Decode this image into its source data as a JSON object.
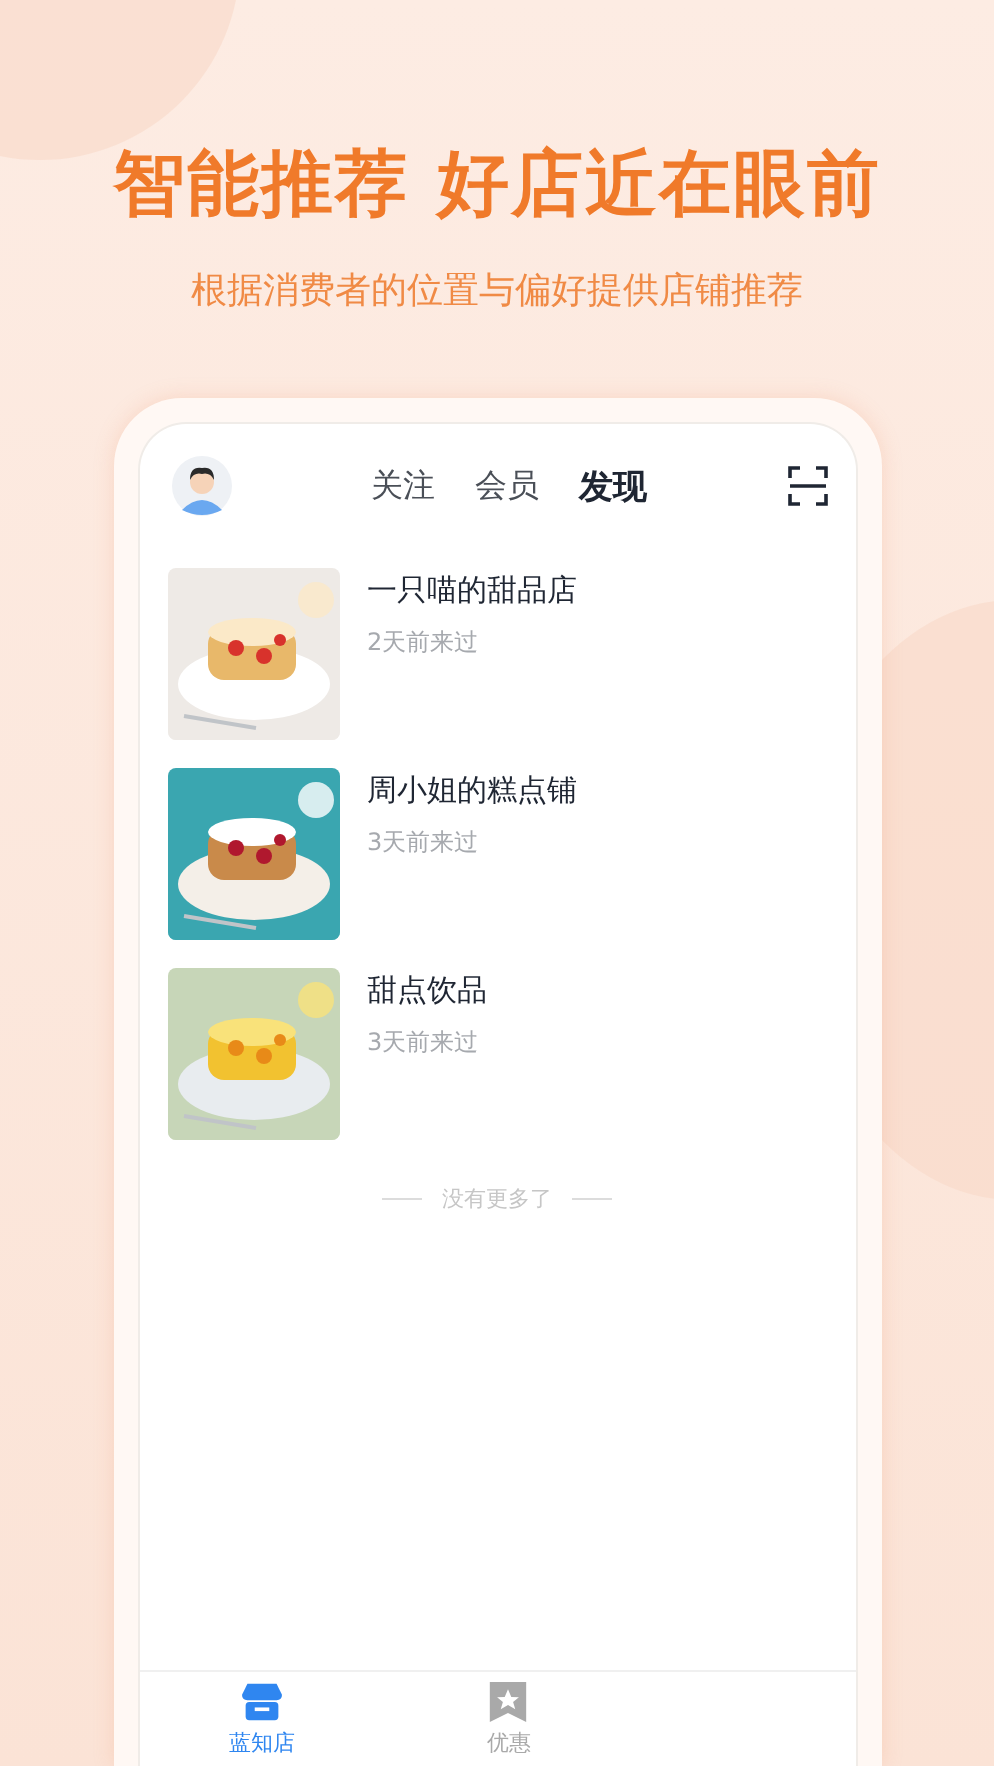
{
  "headline": "智能推荐 好店近在眼前",
  "subtitle": "根据消费者的位置与偏好提供店铺推荐",
  "tabs": [
    {
      "label": "关注",
      "selected": false
    },
    {
      "label": "会员",
      "selected": false
    },
    {
      "label": "发现",
      "selected": true
    }
  ],
  "shops": [
    {
      "name": "一只喵的甜品店",
      "visited": "2天前来过"
    },
    {
      "name": "周小姐的糕点铺",
      "visited": "3天前来过"
    },
    {
      "name": "甜点饮品",
      "visited": "3天前来过"
    }
  ],
  "end_note": "没有更多了",
  "bottom_nav": [
    {
      "label": "蓝知店",
      "selected": true
    },
    {
      "label": "优惠",
      "selected": false
    }
  ]
}
